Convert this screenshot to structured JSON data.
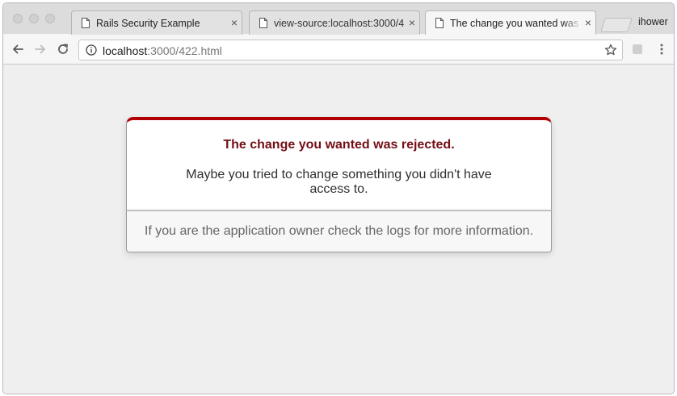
{
  "browser": {
    "tabs": [
      {
        "title": "Rails Security Example",
        "active": false
      },
      {
        "title": "view-source:localhost:3000/4",
        "active": false
      },
      {
        "title": "The change you wanted was",
        "active": true
      }
    ],
    "profile_name": "ihower",
    "address": {
      "host": "localhost",
      "rest": ":3000/422.html"
    }
  },
  "page": {
    "title": "The change you wanted was rejected.",
    "message": "Maybe you tried to change something you didn't have access to.",
    "footer": "If you are the application owner check the logs for more information."
  },
  "colors": {
    "accent_red": "#b00100",
    "title_color": "#730e15",
    "footer_text": "#666666"
  }
}
